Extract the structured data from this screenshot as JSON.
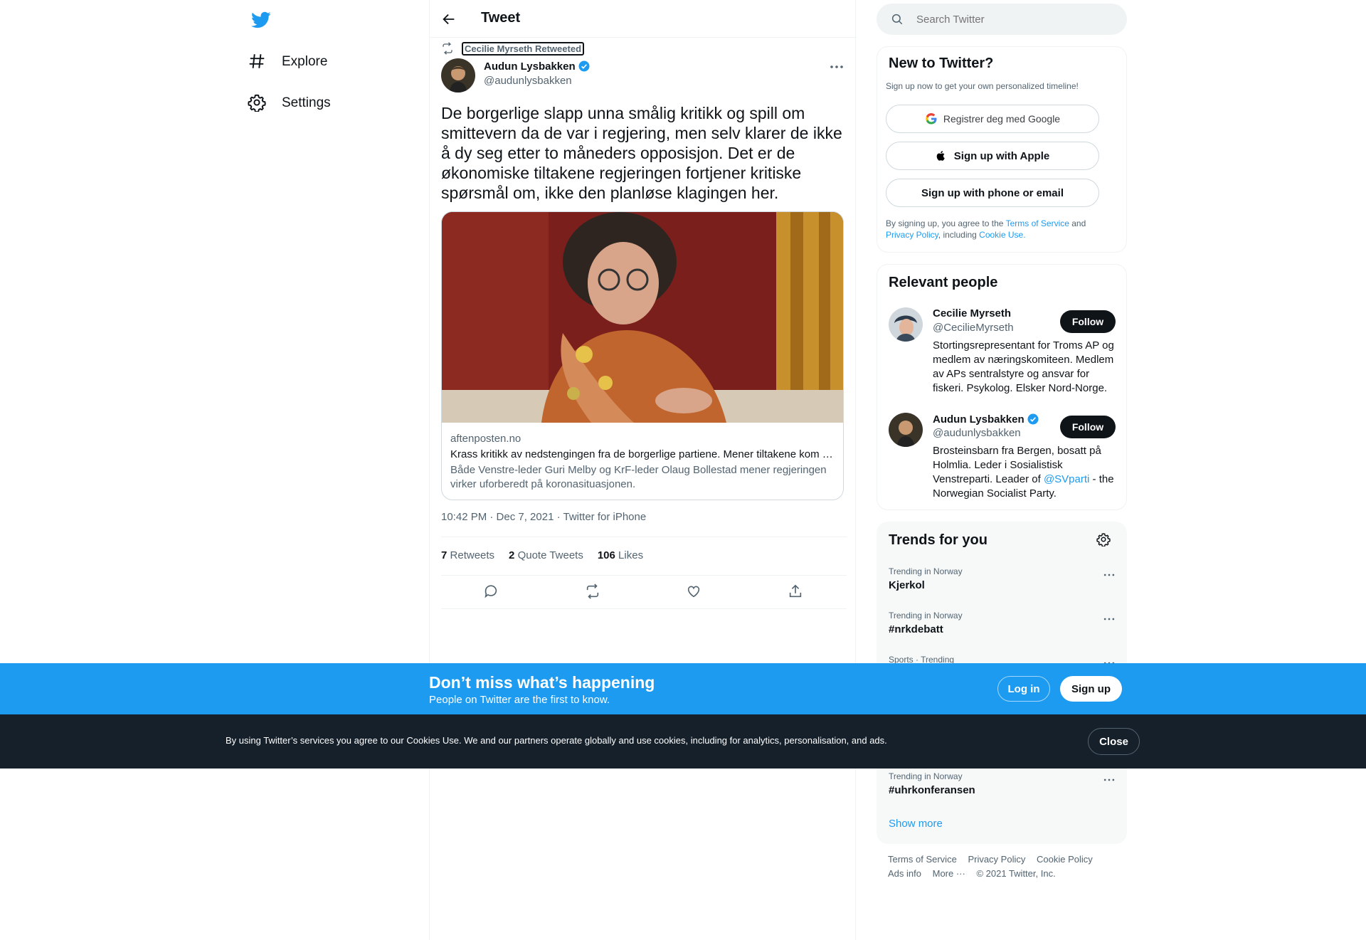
{
  "nav": {
    "logo_icon": "twitter-bird-icon",
    "items": [
      {
        "label": "Explore",
        "icon": "hashtag-icon"
      },
      {
        "label": "Settings",
        "icon": "gear-icon"
      }
    ]
  },
  "header": {
    "title": "Tweet",
    "back_icon": "arrow-left-icon"
  },
  "tweet": {
    "retweeted_by": "Cecilie Myrseth Retweeted",
    "author_name": "Audun Lysbakken",
    "author_handle": "@audunlysbakken",
    "text": "De borgerlige slapp unna smålig kritikk og spill om smittevern da de var i regjering, men selv klarer de ikke å dy seg etter to måneders opposisjon. Det er de økonomiske tiltakene regjeringen fortjener kritiske spørsmål om, ikke den planløse klagingen her.",
    "card": {
      "domain": "aftenposten.no",
      "title": "Krass kritikk av nedstengingen fra de borgerlige partiene. Mener tiltakene kom …",
      "description": "Både Venstre-leder Guri Melby og KrF-leder Olaug Bollestad mener regjeringen virker uforberedt på koronasituasjonen."
    },
    "meta": "10:42 PM · Dec 7, 2021 · Twitter for iPhone",
    "stats": {
      "retweets_count": "7",
      "retweets_label": "Retweets",
      "quotes_count": "2",
      "quotes_label": "Quote Tweets",
      "likes_count": "106",
      "likes_label": "Likes"
    }
  },
  "search": {
    "placeholder": "Search Twitter"
  },
  "new_to_twitter": {
    "title": "New to Twitter?",
    "subtitle": "Sign up now to get your own personalized timeline!",
    "google_label": "Registrer deg med Google",
    "apple_label": "Sign up with Apple",
    "phone_label": "Sign up with phone or email",
    "legal_1": "By signing up, you agree to the ",
    "legal_tos": "Terms of Service",
    "legal_2": " and ",
    "legal_privacy": "Privacy Policy",
    "legal_3": ", including ",
    "legal_cookie": "Cookie Use."
  },
  "relevant": {
    "title": "Relevant people",
    "people": [
      {
        "name": "Cecilie Myrseth",
        "handle": "@CecilieMyrseth",
        "bio": "Stortingsrepresentant for Troms AP og medlem av næringskomiteen. Medlem av APs sentralstyre og ansvar for fiskeri. Psykolog. Elsker Nord-Norge.",
        "follow": "Follow"
      },
      {
        "name": "Audun Lysbakken",
        "handle": "@audunlysbakken",
        "bio_1": "Brosteinsbarn fra Bergen, bosatt på Holmlia. Leder i Sosialistisk Venstreparti. Leader of ",
        "bio_link": "@SVparti",
        "bio_2": " - the Norwegian Socialist Party.",
        "follow": "Follow"
      }
    ]
  },
  "trends": {
    "title": "Trends for you",
    "items": [
      {
        "category": "Trending in Norway",
        "name": "Kjerkol"
      },
      {
        "category": "Trending in Norway",
        "name": "#nrkdebatt"
      },
      {
        "category": "Sports · Trending",
        "name": ""
      },
      {
        "category": "Trending in Norway",
        "name": "#uhrkonferansen"
      }
    ],
    "show_more": "Show more"
  },
  "footer": {
    "links": [
      "Terms of Service",
      "Privacy Policy",
      "Cookie Policy"
    ],
    "ads": "Ads info",
    "more": "More ···",
    "copyright": "© 2021 Twitter, Inc."
  },
  "banner": {
    "title": "Don’t miss what’s happening",
    "subtitle": "People on Twitter are the first to know.",
    "login": "Log in",
    "signup": "Sign up"
  },
  "cookie": {
    "text": "By using Twitter’s services you agree to our Cookies Use. We and our partners operate globally and use cookies, including for analytics, personalisation, and ads.",
    "close": "Close"
  },
  "colors": {
    "accent": "#1d9bf0",
    "text": "#0f1419",
    "muted": "#536471",
    "cookie_bg": "#15202b"
  }
}
